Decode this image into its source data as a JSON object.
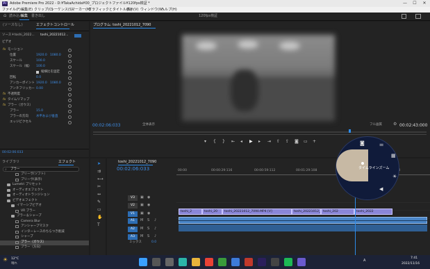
{
  "window": {
    "title": "Adobe Premiere Pro 2022 - D:¥TakaAchida¥00_プロジェクトファイル¥120fps検証 *",
    "logo": "Pr",
    "min": "—",
    "max": "☐",
    "close": "✕"
  },
  "menu": [
    "ファイル(F)",
    "編集(E)",
    "クリップ(C)",
    "シーケンス(S)",
    "マーカー(M)",
    "グラフィックとタイトル(G)",
    "表示(V)",
    "ウィンドウ(W)",
    "ヘルプ(H)"
  ],
  "workspace": {
    "home_icon": "⌂",
    "tabs": [
      "読み込み",
      "編集",
      "書き出し"
    ],
    "active": "編集",
    "project_name": "120fps検証",
    "icons": [
      "share-icon",
      "fullscreen-icon"
    ]
  },
  "source_tabs": [
    "(ソースなし)",
    "エフェクトコントロール",
    "オーディオクリップミキサー"
  ],
  "effect_controls": {
    "source": "ソース＊toshi_2022...",
    "clip": "toshi_20221012...",
    "video_heading": "ビデオ",
    "rows": [
      {
        "label": "モーション",
        "fx": true
      },
      {
        "label": "位置",
        "v1": "1920.0",
        "v2": "1080.0"
      },
      {
        "label": "スケール",
        "v1": "100.0"
      },
      {
        "label": "スケール（幅）",
        "v1": "100.0"
      },
      {
        "label": "縦横比を固定",
        "check": true
      },
      {
        "label": "回転",
        "v1": "0.0"
      },
      {
        "label": "アンカーポイント",
        "v1": "1920.0",
        "v2": "1080.0"
      },
      {
        "label": "アンチフリッカー",
        "v1": "0.00"
      },
      {
        "label": "不透明度",
        "fx": true
      },
      {
        "label": "タイムリマップ",
        "fx": true
      },
      {
        "label": "ブラー（ガウス）",
        "fx": true
      },
      {
        "label": "ブラー",
        "v1": "15.0"
      },
      {
        "label": "ブラーの方向",
        "v1": "水平および垂直"
      },
      {
        "label": "エッジピクセル"
      }
    ],
    "timecode": "00:02:06:033"
  },
  "program": {
    "tab": "プログラム: toshi_20221012_7090",
    "timecode": "00:02:06:033",
    "fit": "全体表示",
    "quality": "フル画質",
    "duration": "00:02:43:000"
  },
  "transport_icons": [
    "marker-icon",
    "in-point-icon",
    "out-point-icon",
    "go-to-in-icon",
    "step-back-icon",
    "play-icon",
    "step-forward-icon",
    "go-to-out-icon",
    "lift-icon",
    "extract-icon",
    "export-frame-icon",
    "comparison-icon",
    "add-icon"
  ],
  "effects_panel": {
    "tabs": [
      "ライブラリ",
      "エフェクト"
    ],
    "search_value": "ブラー",
    "items": [
      {
        "label": "ブリーヴ(ソフト)",
        "indent": 3
      },
      {
        "label": "ブリーヴ(表示)",
        "indent": 3
      },
      {
        "label": "Lumetri プリセット",
        "indent": 1,
        "folder": true
      },
      {
        "label": "オーディオエフェクト",
        "indent": 1,
        "folder": true
      },
      {
        "label": "オーディオトランジション",
        "indent": 1,
        "folder": true
      },
      {
        "label": "ビデオエフェクト",
        "indent": 1,
        "folder": true
      },
      {
        "label": "イマーシブビデオ",
        "indent": 2,
        "folder": true
      },
      {
        "label": "VR ブラー",
        "indent": 3
      },
      {
        "label": "ブラー＆シャープ",
        "indent": 2,
        "folder": true
      },
      {
        "label": "Camera Blur",
        "indent": 3
      },
      {
        "label": "アンシャープマスク",
        "indent": 3
      },
      {
        "label": "インターレースのちらつき削減",
        "indent": 3
      },
      {
        "label": "シャープ",
        "indent": 3
      },
      {
        "label": "ブラー（ガウス）",
        "indent": 3,
        "selected": true
      },
      {
        "label": "ブラー（方向）",
        "indent": 3
      }
    ]
  },
  "timeline": {
    "tab": "toshi_20221012_7090",
    "timecode": "00:02:06:033",
    "ruler": [
      "00:00",
      "00:00:29:116",
      "00:00:59:112",
      "00:01:29:108",
      "00:01:59:104",
      "00:02:29:100"
    ],
    "video_tracks": [
      "V3",
      "V2",
      "V1"
    ],
    "audio_tracks": [
      "A1",
      "A2",
      "A3"
    ],
    "mix_label": "ミックス",
    "mix_value": "0.0",
    "clips_v1": [
      "toshi_2",
      "toshi_20",
      "toshi_20221012_7090.MP4 [V]",
      "toshi_20221012_7089.MP4 [V]",
      "toshi_202",
      "toshi_2022"
    ],
    "zoom_popup": "タイムラインズーム"
  },
  "tools": [
    "selection-tool-icon",
    "track-select-icon",
    "ripple-edit-icon",
    "razor-icon",
    "slip-icon",
    "pen-icon",
    "rectangle-icon",
    "hand-icon",
    "type-icon"
  ],
  "taskbar": {
    "weather_temp": "12°C",
    "weather_desc": "晴れ",
    "time": "7:41",
    "date": "2022/11/16",
    "lang": "A"
  },
  "colors": {
    "accent": "#2d8ceb",
    "clip_video": "#8a86d8",
    "clip_audio": "#4a86c8",
    "playhead": "#2d8ceb"
  }
}
